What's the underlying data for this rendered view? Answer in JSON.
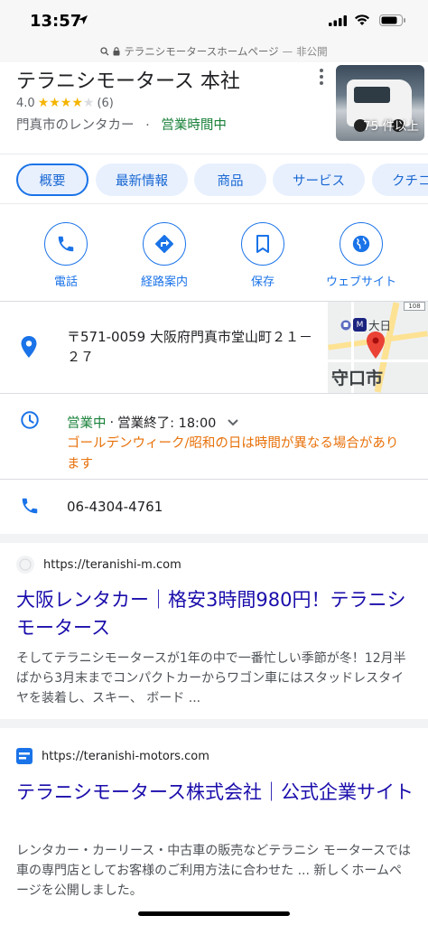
{
  "status_bar": {
    "time": "13:57"
  },
  "url_bar": {
    "title": "テラニシモータースホームページ",
    "separator": "—",
    "security": "非公開"
  },
  "place": {
    "name": "テラニシモータース 本社",
    "rating": "4.0",
    "stars": 4,
    "reviews": "(6)",
    "category": "門真市のレンタカー",
    "dot": "·",
    "open_status": "営業時間中",
    "photo_count": "75 件以上"
  },
  "chips": [
    "概要",
    "最新情報",
    "商品",
    "サービス",
    "クチコミ"
  ],
  "actions": [
    {
      "label": "電話",
      "icon": "phone-icon"
    },
    {
      "label": "経路案内",
      "icon": "directions-icon"
    },
    {
      "label": "保存",
      "icon": "bookmark-icon"
    },
    {
      "label": "ウェブサイト",
      "icon": "globe-icon"
    }
  ],
  "address": {
    "text": "〒571-0059 大阪府門真市堂山町２１－２７",
    "map_station": "大日",
    "map_city": "守口市",
    "map_route": "108",
    "map_station_badge": "M"
  },
  "hours": {
    "status": "営業中",
    "dot": "·",
    "closing": "営業終了: 18:00",
    "notice": "ゴールデンウィーク/昭和の日は時間が異なる場合があります"
  },
  "phone": {
    "number": "06-4304-4761"
  },
  "results": [
    {
      "url": "https://teranishi-m.com",
      "title": "大阪レンタカー｜格安3時間980円！テラニシモータース",
      "snippet": "そしてテラニシモータースが1年の中で一番忙しい季節が冬！12月半ばから3月末までコンパクトカーからワゴン車にはスタッドレスタイヤを装着し、スキー、 ボード ..."
    },
    {
      "url": "https://teranishi-motors.com",
      "title": "テラニシモータース株式会社｜公式企業サイト",
      "snippet": "レンタカー・カーリース・中古車の販売などテラニシ モータースでは車の専門店としてお客様のご利用方法に合わせた ... 新しくホームページを公開しました。"
    }
  ],
  "colors": {
    "accent_blue": "#1a73e8",
    "open_green": "#188038",
    "warning_orange": "#e8710a",
    "link": "#1a0dab",
    "star": "#f4b400"
  }
}
